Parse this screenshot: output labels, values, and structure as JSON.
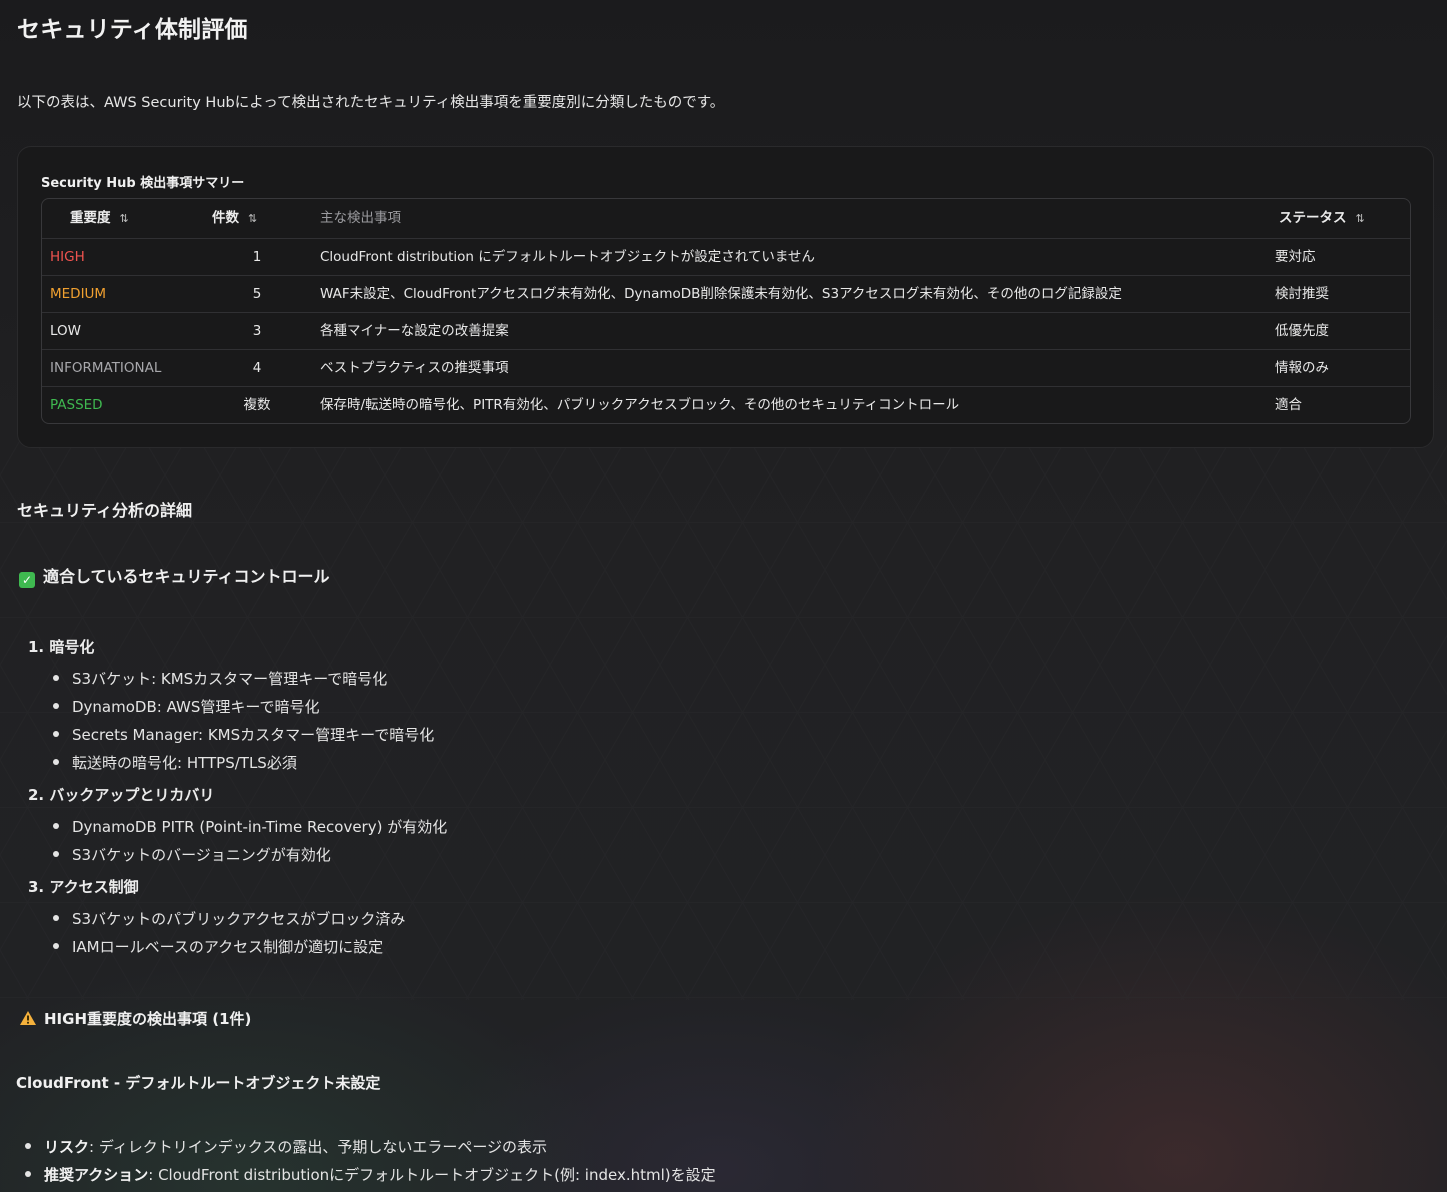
{
  "page_title": "セキュリティ体制評価",
  "intro_text": "以下の表は、AWS Security Hubによって検出されたセキュリティ検出事項を重要度別に分類したものです。",
  "summary": {
    "title": "Security Hub 検出事項サマリー",
    "sort_icon": "⇅",
    "columns": {
      "severity": "重要度",
      "count": "件数",
      "findings": "主な検出事項",
      "status": "ステータス"
    },
    "rows": [
      {
        "severity": "HIGH",
        "color": "#f0534f",
        "count": "1",
        "findings": "CloudFront distribution にデフォルトルートオブジェクトが設定されていません",
        "status": "要対応"
      },
      {
        "severity": "MEDIUM",
        "color": "#f0a030",
        "count": "5",
        "findings": "WAF未設定、CloudFrontアクセスログ未有効化、DynamoDB削除保護未有効化、S3アクセスログ未有効化、その他のログ記録設定",
        "status": "検討推奨"
      },
      {
        "severity": "LOW",
        "color": "#e8e8e8",
        "count": "3",
        "findings": "各種マイナーな設定の改善提案",
        "status": "低優先度"
      },
      {
        "severity": "INFORMATIONAL",
        "color": "#a8a8ac",
        "count": "4",
        "findings": "ベストプラクティスの推奨事項",
        "status": "情報のみ"
      },
      {
        "severity": "PASSED",
        "color": "#3fb950",
        "count": "複数",
        "findings": "保存時/転送時の暗号化、PITR有効化、パブリックアクセスブロック、その他のセキュリティコントロール",
        "status": "適合"
      }
    ]
  },
  "analysis_heading": "セキュリティ分析の詳細",
  "compliant": {
    "icon": "check-icon",
    "heading": "適合しているセキュリティコントロール",
    "groups": [
      {
        "title": "1. 暗号化",
        "items": [
          "S3バケット: KMSカスタマー管理キーで暗号化",
          "DynamoDB: AWS管理キーで暗号化",
          "Secrets Manager: KMSカスタマー管理キーで暗号化",
          "転送時の暗号化: HTTPS/TLS必須"
        ]
      },
      {
        "title": "2. バックアップとリカバリ",
        "items": [
          "DynamoDB PITR (Point-in-Time Recovery) が有効化",
          "S3バケットのバージョニングが有効化"
        ]
      },
      {
        "title": "3. アクセス制御",
        "items": [
          "S3バケットのパブリックアクセスがブロック済み",
          "IAMロールベースのアクセス制御が適切に設定"
        ]
      }
    ]
  },
  "high_findings": {
    "icon": "warning-icon",
    "heading": "HIGH重要度の検出事項 (1件)",
    "finding_title": "CloudFront - デフォルトルートオブジェクト未設定",
    "items": [
      {
        "label": "リスク",
        "text": ": ディレクトリインデックスの露出、予期しないエラーページの表示"
      },
      {
        "label": "推奨アクション",
        "text": ": CloudFront distributionにデフォルトルートオブジェクト(例: index.html)を設定"
      }
    ]
  }
}
